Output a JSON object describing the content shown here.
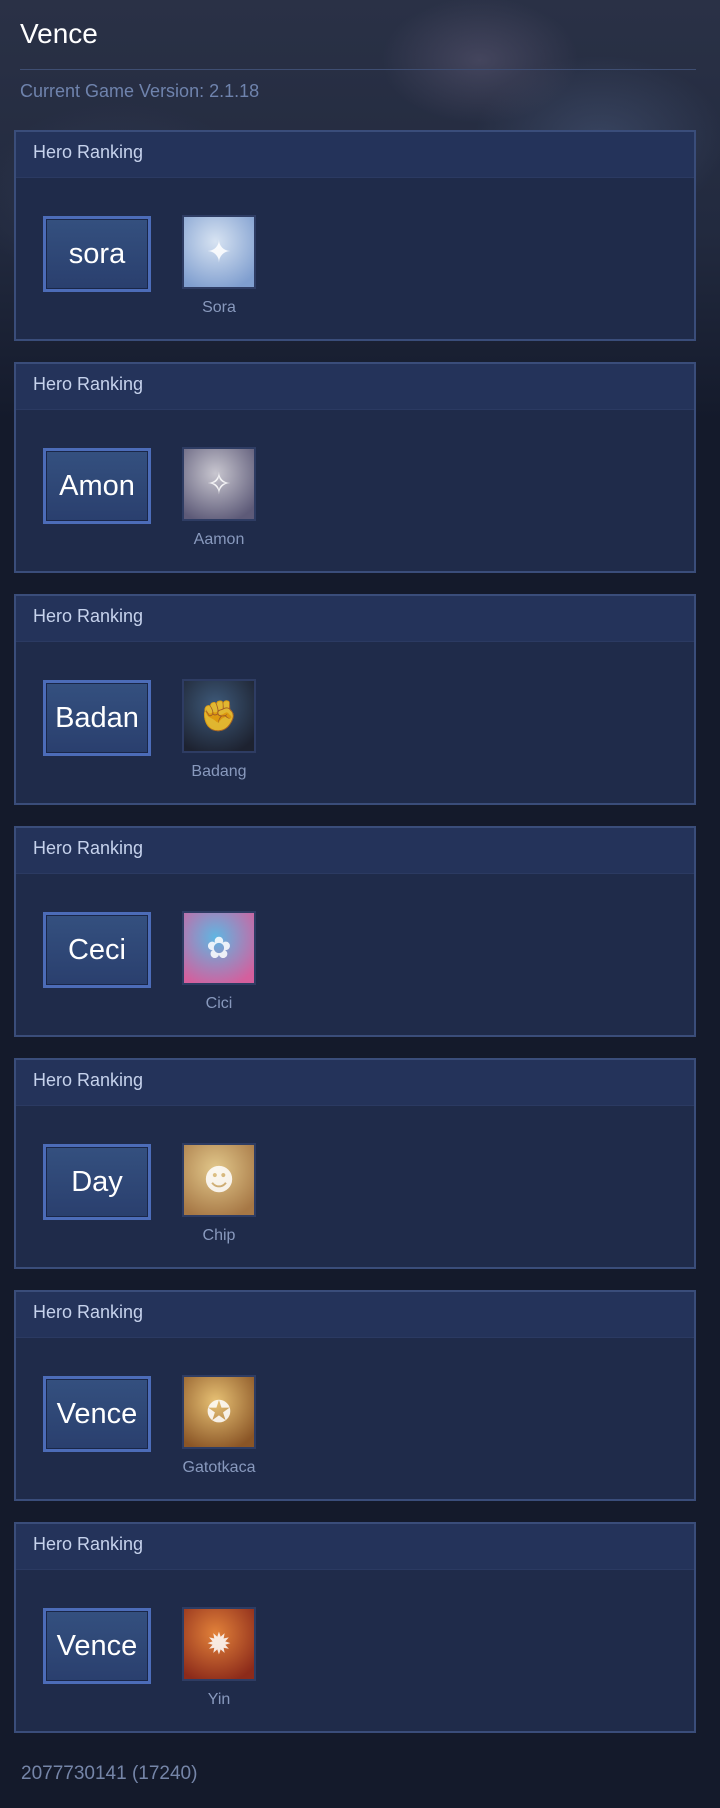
{
  "app": {
    "title": "Vence",
    "version_label": "Current Game Version: 2.1.18"
  },
  "cards": [
    {
      "header": "Hero Ranking",
      "name_button": "sora",
      "hero_name": "Sora",
      "portrait_icon": "✦",
      "portrait_colors": [
        "#d7e3f2",
        "#7f9ecf"
      ]
    },
    {
      "header": "Hero Ranking",
      "name_button": "Amon",
      "hero_name": "Aamon",
      "portrait_icon": "✧",
      "portrait_colors": [
        "#c8c6cf",
        "#5d5a78"
      ]
    },
    {
      "header": "Hero Ranking",
      "name_button": "Badan",
      "hero_name": "Badang",
      "portrait_icon": "✊",
      "portrait_colors": [
        "#3e5a7a",
        "#1d2230"
      ]
    },
    {
      "header": "Hero Ranking",
      "name_button": "Ceci",
      "hero_name": "Cici",
      "portrait_icon": "✿",
      "portrait_colors": [
        "#5fb6e2",
        "#d45f9d"
      ]
    },
    {
      "header": "Hero Ranking",
      "name_button": "Day",
      "hero_name": "Chip",
      "portrait_icon": "☻",
      "portrait_colors": [
        "#e2c88b",
        "#a67745"
      ]
    },
    {
      "header": "Hero Ranking",
      "name_button": "Vence",
      "hero_name": "Gatotkaca",
      "portrait_icon": "✪",
      "portrait_colors": [
        "#e7c174",
        "#8a5526"
      ]
    },
    {
      "header": "Hero Ranking",
      "name_button": "Vence",
      "hero_name": "Yin",
      "portrait_icon": "✹",
      "portrait_colors": [
        "#e2823a",
        "#8c2a1a"
      ]
    }
  ],
  "footer": {
    "id_text": "2077730141 (17240)"
  }
}
